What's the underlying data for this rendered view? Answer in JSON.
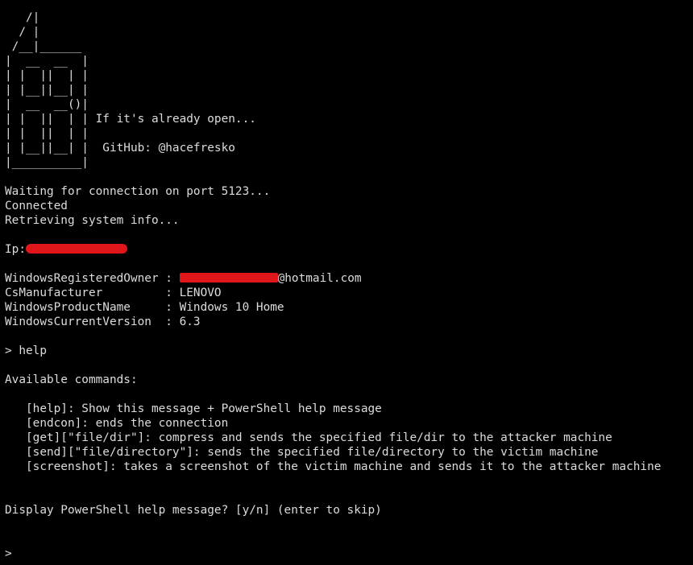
{
  "banner": {
    "art": [
      "   /|",
      "  / |",
      " /__|______",
      "|  __  __  |",
      "| |  ||  | |",
      "| |__||__| |",
      "|  __  __()|",
      "| |  ||  | |",
      "| |  ||  | |",
      "| |__||__| |",
      "|__________|"
    ],
    "tagline": "If it's already open...",
    "github": "GitHub: @hacefresko"
  },
  "session": {
    "waiting": "Waiting for connection on port 5123...",
    "connected": "Connected",
    "retrieving": "Retrieving system info..."
  },
  "sysinfo": {
    "ip_label": "Ip:",
    "owner_label": "WindowsRegisteredOwner : ",
    "owner_suffix": "@hotmail.com",
    "manufacturer_line": "CsManufacturer         : LENOVO",
    "product_line": "WindowsProductName     : Windows 10 Home",
    "version_line": "WindowsCurrentVersion  : 6.3"
  },
  "help_command": "> help",
  "available_header": "Available commands:",
  "commands": [
    "   [help]: Show this message + PowerShell help message",
    "   [endcon]: ends the connection",
    "   [get][\"file/dir\"]: compress and sends the specified file/dir to the attacker machine",
    "   [send][\"file/directory\"]: sends the specified file/directory to the victim machine",
    "   [screenshot]: takes a screenshot of the victim machine and sends it to the attacker machine"
  ],
  "prompt_question": "Display PowerShell help message? [y/n] (enter to skip)",
  "prompt": ">",
  "colors": {
    "background": "#000000",
    "text": "#dcdcdc",
    "redaction": "#e0161a"
  }
}
